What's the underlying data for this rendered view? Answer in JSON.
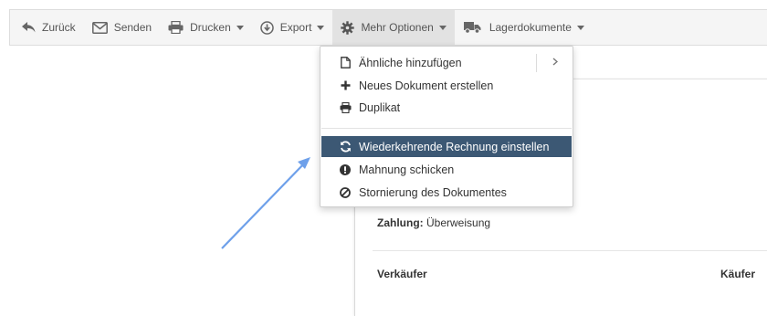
{
  "toolbar": {
    "items": [
      {
        "label": "Zurück",
        "icon": "reply-icon"
      },
      {
        "label": "Senden",
        "icon": "envelope-icon"
      },
      {
        "label": "Drucken",
        "icon": "printer-icon"
      },
      {
        "label": "Export",
        "icon": "download-icon"
      },
      {
        "label": "Mehr Optionen",
        "icon": "gear-icon"
      },
      {
        "label": "Lagerdokumente",
        "icon": "truck-icon"
      }
    ]
  },
  "menu": {
    "items": [
      {
        "label": "Ähnliche hinzufügen",
        "icon": "file-icon"
      },
      {
        "label": "Neues Dokument erstellen",
        "icon": "plus-icon"
      },
      {
        "label": "Duplikat",
        "icon": "printer-icon"
      },
      {
        "label": "Wiederkehrende Rechnung einstellen",
        "icon": "refresh-icon"
      },
      {
        "label": "Mahnung schicken",
        "icon": "exclamation-circle-icon"
      },
      {
        "label": "Stornierung des Dokumentes",
        "icon": "ban-icon"
      }
    ],
    "highlight_color": "#3c5874"
  },
  "document": {
    "payment_label": "Zahlung:",
    "payment_value": "Überweisung",
    "seller_heading": "Verkäufer",
    "buyer_heading": "Käufer"
  },
  "annotation": {
    "arrow_color": "#6ea0ea"
  }
}
